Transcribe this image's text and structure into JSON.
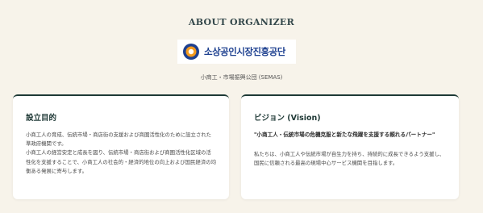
{
  "section": {
    "heading": "ABOUT ORGANIZER",
    "logo_text": "소상공인시장진흥공단",
    "subtitle": "小商工・市場振興公団 (SEMAS)"
  },
  "cards": [
    {
      "title": "設立目的",
      "body": [
        "小商工人の育成、伝統市場・商店街の支援および商圏活性化のために設立された準政府機関です。",
        "小商工人の経営安定と成長を図り、伝統市場・商店街および商圏活性化区域の活性化を支援することで、小商工人の社会的・経済的地位の向上および国民経済の均衡ある発展に寄与します。"
      ]
    },
    {
      "title": "ビジョン (Vision)",
      "quote": "\"小商工人・伝統市場の危機克服と新たな飛躍を支援する頼れるパートナー\"",
      "body": [
        "私たちは、小商工人や伝統市場が自生力を持ち、持続的に成長できるよう支援し、国民に信頼される最高の現場中心サービス機関を目指します。"
      ]
    }
  ],
  "colors": {
    "background": "#f7f3ea",
    "card_border": "#1e3a36",
    "logo_blue": "#1c3f8f",
    "logo_orange": "#f29a1f"
  },
  "icons": {
    "logo": "semas-logo-icon"
  }
}
